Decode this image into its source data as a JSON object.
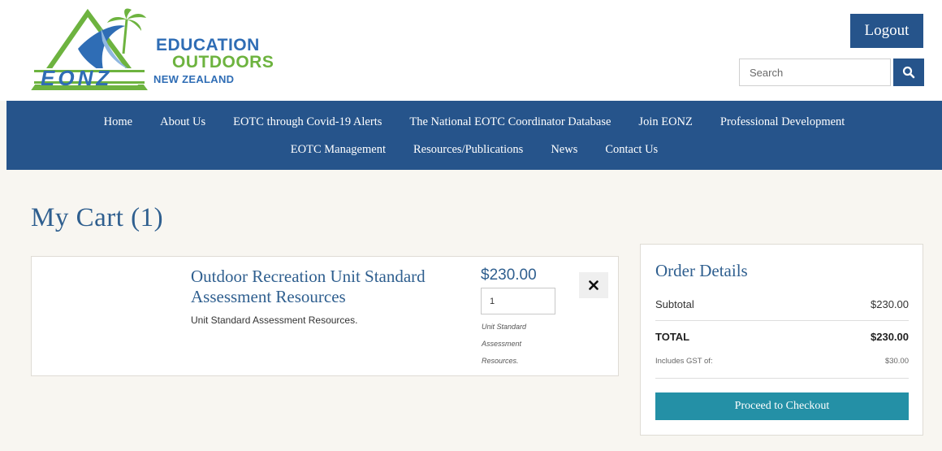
{
  "header": {
    "logo": {
      "line1": "EDUCATION",
      "line2": "OUTDOORS",
      "line3": "NEW ZEALAND",
      "acronym": "EONZ"
    },
    "logout_label": "Logout",
    "search": {
      "placeholder": "Search",
      "icon": "search-icon"
    }
  },
  "nav": {
    "row1": [
      "Home",
      "About Us",
      "EOTC through Covid-19 Alerts",
      "The National EOTC Coordinator Database",
      "Join EONZ",
      "Professional Development"
    ],
    "row2": [
      "EOTC Management",
      "Resources/Publications",
      "News",
      "Contact Us"
    ]
  },
  "page": {
    "title": "My Cart (1)"
  },
  "cart": {
    "items": [
      {
        "name": "Outdoor Recreation Unit Standard Assessment Resources",
        "description": "Unit Standard Assessment Resources.",
        "price": "$230.00",
        "quantity": "1",
        "note": "Unit Standard Assessment Resources.",
        "remove_icon": "close-icon"
      }
    ]
  },
  "order": {
    "title": "Order Details",
    "subtotal_label": "Subtotal",
    "subtotal_value": "$230.00",
    "total_label": "TOTAL",
    "total_value": "$230.00",
    "gst_label": "Includes GST of:",
    "gst_value": "$30.00",
    "checkout_label": "Proceed to Checkout"
  },
  "colors": {
    "primary": "#26548b",
    "heading": "#2f5f8f",
    "checkout": "#2490a6",
    "background": "#f8f6f1",
    "logo_green": "#6db33f"
  }
}
